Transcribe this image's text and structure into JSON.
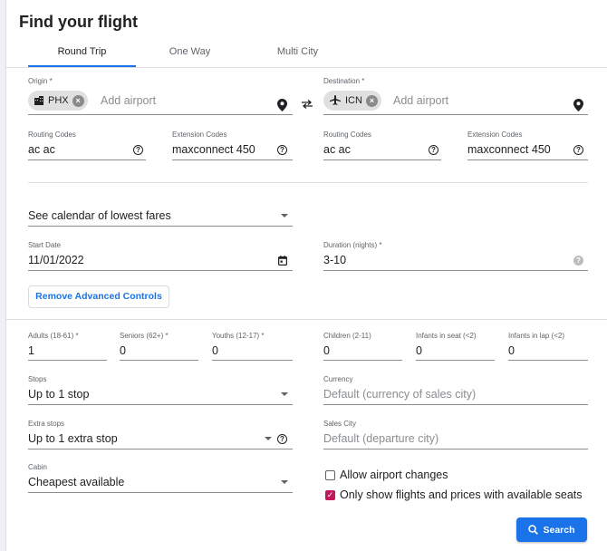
{
  "title": "Find your flight",
  "tabs": [
    {
      "label": "Round Trip"
    },
    {
      "label": "One Way"
    },
    {
      "label": "Multi City"
    }
  ],
  "origin": {
    "label": "Origin *",
    "chip": "PHX",
    "placeholder": "Add airport"
  },
  "destination": {
    "label": "Destination *",
    "chip": "ICN",
    "placeholder": "Add airport"
  },
  "origin_codes": {
    "routing_label": "Routing Codes",
    "routing_value": "ac ac",
    "extension_label": "Extension Codes",
    "extension_value": "maxconnect 450"
  },
  "destination_codes": {
    "routing_label": "Routing Codes",
    "routing_value": "ac ac",
    "extension_label": "Extension Codes",
    "extension_value": "maxconnect 450"
  },
  "calendar": {
    "value": "See calendar of lowest fares"
  },
  "start_date": {
    "label": "Start Date",
    "value": "11/01/2022"
  },
  "duration": {
    "label": "Duration (nights) *",
    "value": "3-10"
  },
  "remove_advanced_label": "Remove Advanced Controls",
  "passengers": [
    {
      "label": "Adults (18-61) *",
      "value": "1"
    },
    {
      "label": "Seniors (62+) *",
      "value": "0"
    },
    {
      "label": "Youths (12-17) *",
      "value": "0"
    },
    {
      "label": "Children (2-11)",
      "value": "0"
    },
    {
      "label": "Infants in seat (<2)",
      "value": "0"
    },
    {
      "label": "Infants in lap (<2)",
      "value": "0"
    }
  ],
  "stops": {
    "label": "Stops",
    "value": "Up to 1 stop"
  },
  "currency": {
    "label": "Currency",
    "placeholder": "Default (currency of sales city)"
  },
  "extra_stops": {
    "label": "Extra stops",
    "value": "Up to 1 extra stop"
  },
  "sales_city": {
    "label": "Sales City",
    "placeholder": "Default (departure city)"
  },
  "cabin": {
    "label": "Cabin",
    "value": "Cheapest available"
  },
  "checkboxes": [
    {
      "label": "Allow airport changes",
      "checked": false
    },
    {
      "label": "Only show flights and prices with available seats",
      "checked": true
    }
  ],
  "search_label": "Search",
  "colors": {
    "accent": "#1a73e8",
    "checkbox": "#c2185b"
  },
  "icons": [
    "building-icon",
    "clear-icon",
    "location-pin-icon",
    "swap-icon",
    "plane-icon",
    "help-icon",
    "calendar-icon",
    "chevron-down-icon",
    "search-icon"
  ]
}
